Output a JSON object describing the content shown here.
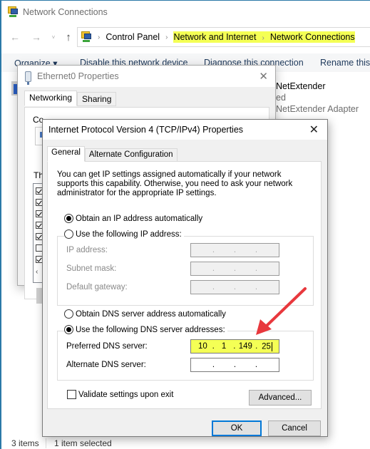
{
  "explorer": {
    "title": "Network Connections",
    "nav": {
      "back": "←",
      "forward": "→",
      "recent": "˅",
      "up": "↑"
    },
    "breadcrumb": [
      "Control Panel",
      "Network and Internet",
      "Network Connections"
    ],
    "breadcrumb_sep": "›",
    "commands": [
      "Organize ▾",
      "Disable this network device",
      "Diagnose this connection",
      "Rename this c"
    ],
    "adapter": {
      "name": "NetExtender",
      "status": "ed",
      "device": "NetExtender Adapter"
    },
    "status": {
      "items": "3 items",
      "selected": "1 item selected"
    }
  },
  "ethernet_dialog": {
    "title": "Ethernet0 Properties",
    "tabs": [
      "Networking",
      "Sharing"
    ],
    "connect_label": "Co",
    "list_label": "Th",
    "items_checked": [
      true,
      true,
      true,
      true,
      true,
      false,
      true
    ]
  },
  "ipv4_dialog": {
    "title": "Internet Protocol Version 4 (TCP/IPv4) Properties",
    "tabs": [
      "General",
      "Alternate Configuration"
    ],
    "intro": "You can get IP settings assigned automatically if your network supports this capability. Otherwise, you need to ask your network administrator for the appropriate IP settings.",
    "ip_auto_label": "Obtain an IP address automatically",
    "ip_auto_selected": true,
    "ip_manual_label": "Use the following IP address:",
    "ip_fields": [
      {
        "label": "IP address:",
        "octets": [
          "",
          "",
          "",
          ""
        ]
      },
      {
        "label": "Subnet mask:",
        "octets": [
          "",
          "",
          "",
          ""
        ]
      },
      {
        "label": "Default gateway:",
        "octets": [
          "",
          "",
          "",
          ""
        ]
      }
    ],
    "dns_auto_label": "Obtain DNS server address automatically",
    "dns_manual_label": "Use the following DNS server addresses:",
    "dns_manual_selected": true,
    "dns_fields": [
      {
        "label": "Preferred DNS server:",
        "octets": [
          "10",
          "1",
          "149",
          "25"
        ]
      },
      {
        "label": "Alternate DNS server:",
        "octets": [
          "",
          "",
          "",
          ""
        ]
      }
    ],
    "validate_label": "Validate settings upon exit",
    "validate_checked": false,
    "advanced_label": "Advanced...",
    "ok_label": "OK",
    "cancel_label": "Cancel",
    "close_glyph": "✕",
    "highlight_color": "#f4ff55",
    "annotation_arrow_color": "#e8383d"
  }
}
